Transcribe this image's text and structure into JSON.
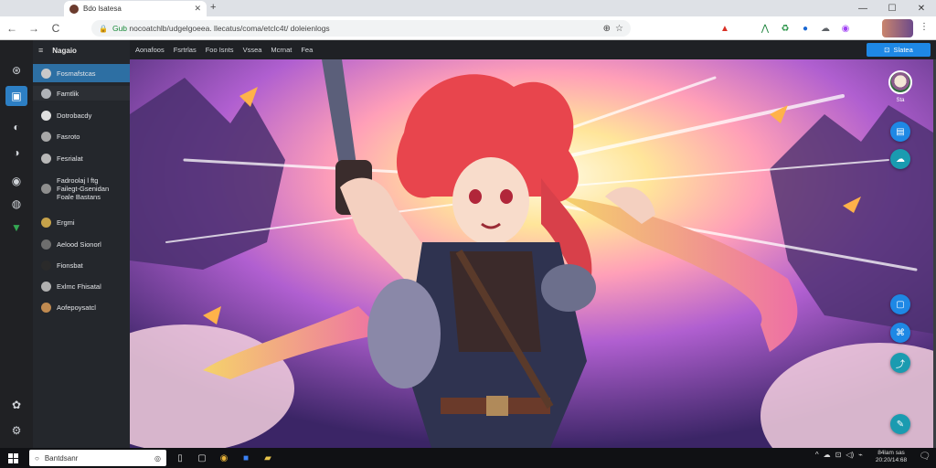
{
  "browser": {
    "tab_title": "Bdo lsatesa",
    "new_tab": "+",
    "window_controls": {
      "minimize": "—",
      "maximize": "☐",
      "close": "✕"
    },
    "nav": {
      "back": "←",
      "forward": "→",
      "reload": "C"
    },
    "url_domain": "Gub",
    "url_rest": "nocoatchlb/udgelgoeea. llecatus/coma/etclc4t/ doleienlogs",
    "star": "☆",
    "menu": "⋮"
  },
  "rail": {
    "icons": [
      "home-icon",
      "image-icon",
      "layers-icon",
      "share-icon",
      "cloud-icon",
      "download-icon"
    ],
    "bottom_icons": [
      "settings-icon",
      "gear-icon"
    ]
  },
  "sidebar": {
    "header": "Nagaio",
    "items": [
      {
        "label": "Fosmafstcas",
        "icon_color": "#c9c9c9",
        "active": true
      },
      {
        "label": "Famtlik",
        "icon_color": "#b0b3b8",
        "sub": true
      },
      {
        "label": "Dotrobacdy",
        "icon_color": "#e0e0e0"
      },
      {
        "label": "Fasroto",
        "icon_color": "#a8a8a8"
      },
      {
        "label": "Fesrialat",
        "icon_color": "#b8b8b8"
      },
      {
        "label": "Fadroolaj l ftg\nFailegt-Gsenidan\nFoale Bastans",
        "icon_color": "#8e8e8e"
      },
      {
        "label": "Ergmi",
        "icon_color": "#c6a24a"
      },
      {
        "label": "Aelood Sionorl",
        "icon_color": "#6e6e6e"
      },
      {
        "label": "Fionsbat",
        "icon_color": "#2a2a2a"
      },
      {
        "label": "Exlmc Fhisatal",
        "icon_color": "#b0b0b0"
      },
      {
        "label": "Aofepoysatcl",
        "icon_color": "#c08a50"
      }
    ]
  },
  "topbar": {
    "menu": [
      "Aonafoos",
      "Fsrtrlas",
      "Foo Isnts",
      "Vssea",
      "Mcrnat",
      "Fea"
    ],
    "share_label": "Slatea"
  },
  "fabs": {
    "avatar_label": "Sta",
    "buttons": [
      "save-icon",
      "cloud-icon",
      "chat-icon",
      "image-edit-icon",
      "share-icon",
      "edit-icon"
    ]
  },
  "taskbar": {
    "search_placeholder": "Bantdsanr",
    "apps": [
      "task-view-icon",
      "file-icon",
      "browser-icon",
      "mail-icon",
      "folder-icon"
    ],
    "tray": [
      "^",
      "☁",
      "⊡",
      "◁)",
      "⌁"
    ],
    "clock_line1": "84lam sas",
    "clock_line2": "20:20/14:68"
  },
  "colors": {
    "accent": "#1e88e5",
    "active_item": "#2d6fa3",
    "url_green": "#1a8a3a"
  }
}
